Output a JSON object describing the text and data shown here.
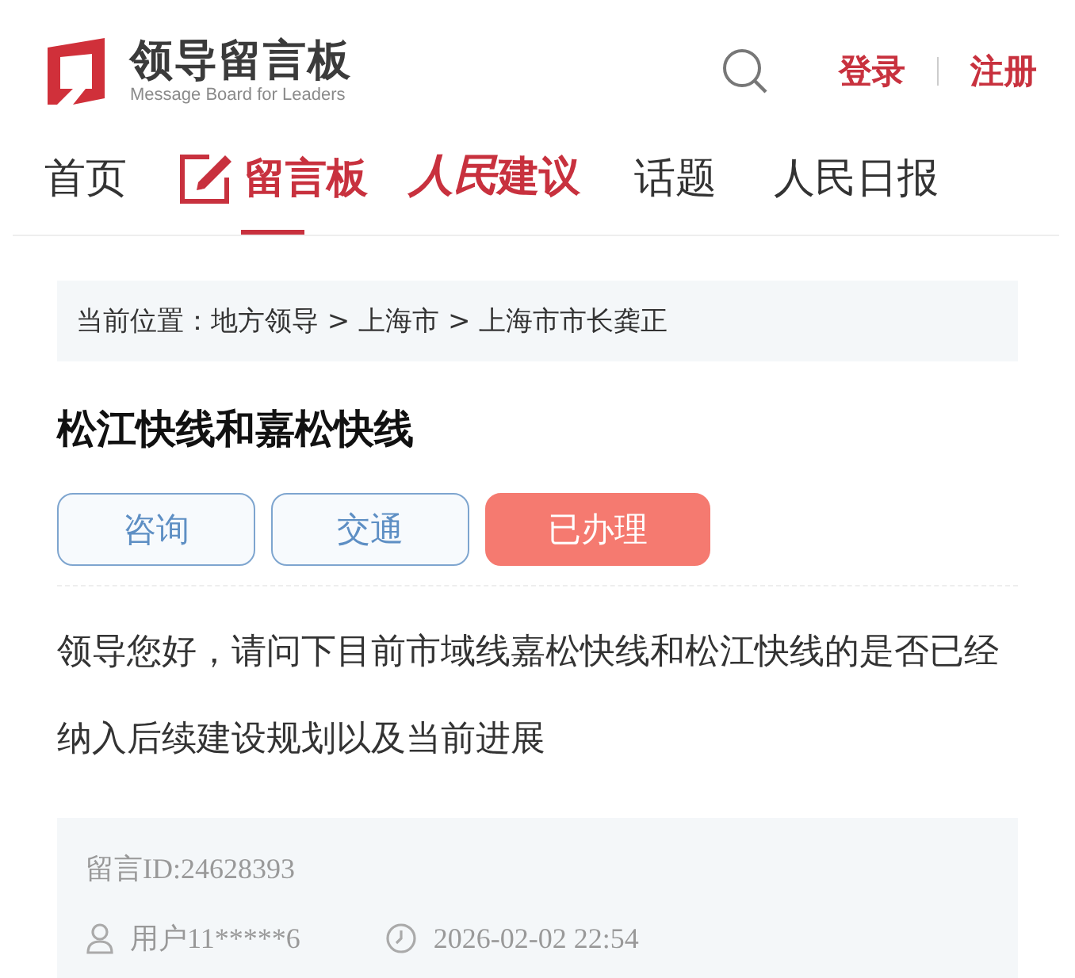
{
  "header": {
    "logo_title": "领导留言板",
    "logo_subtitle": "Message Board for Leaders",
    "login": "登录",
    "register": "注册"
  },
  "nav": [
    {
      "label": "首页",
      "kind": "plain",
      "selected": false
    },
    {
      "label": "留言板",
      "kind": "board",
      "selected": true
    },
    {
      "label_script": "人民",
      "label": "建议",
      "kind": "script",
      "selected": false
    },
    {
      "label": "话题",
      "kind": "plain",
      "selected": false
    },
    {
      "label": "人民日报",
      "kind": "plain",
      "selected": false
    }
  ],
  "breadcrumb": "当前位置：地方领导 > 上海市 > 上海市市长龚正",
  "title": "松江快线和嘉松快线",
  "tags": [
    {
      "label": "咨询",
      "kind": "category"
    },
    {
      "label": "交通",
      "kind": "category"
    },
    {
      "label": "已办理",
      "kind": "status"
    }
  ],
  "body": "领导您好，请问下目前市域线嘉松快线和松江快线的是否已经纳入后续建设规划以及当前进展",
  "meta": {
    "message_id": "留言ID:24628393",
    "user": "用户11*****6",
    "time": "2026-02-02 22:54"
  }
}
